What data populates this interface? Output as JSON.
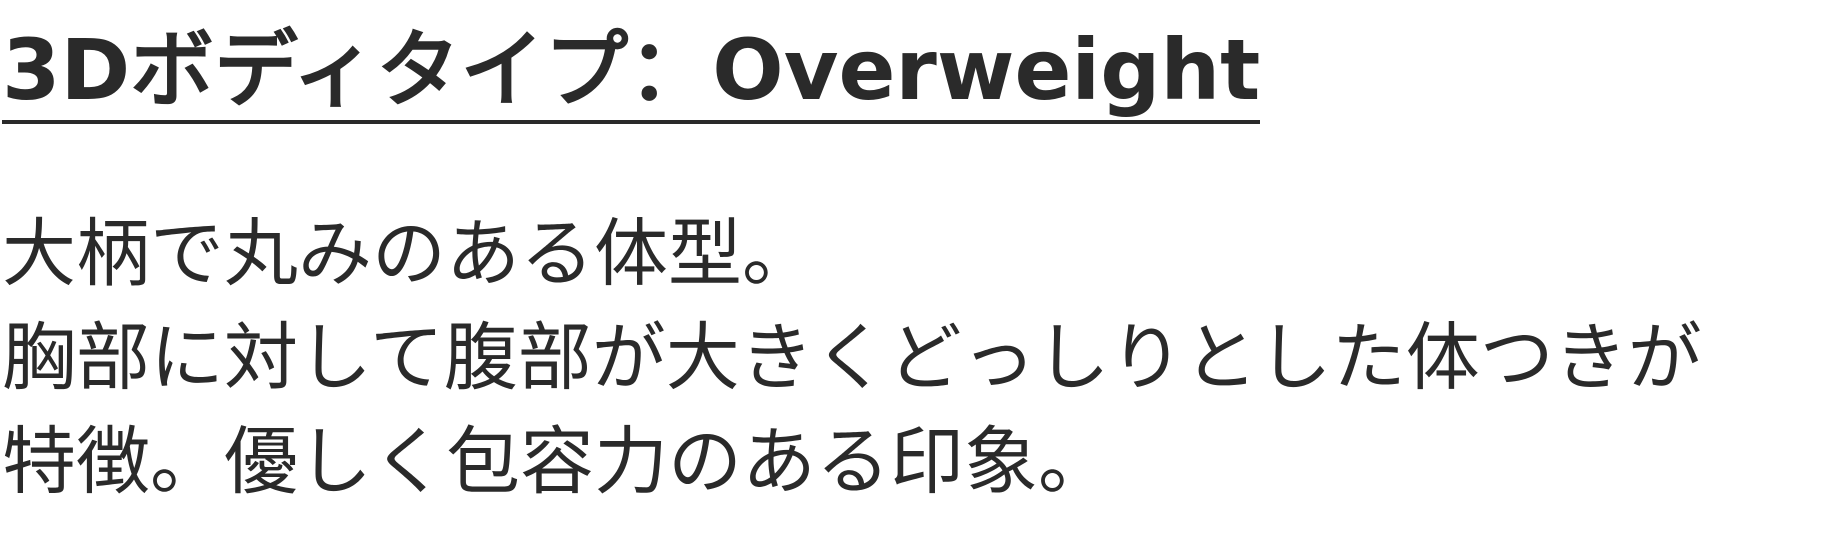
{
  "document": {
    "title": "3Dボディタイプ：Overweight",
    "lines": [
      "大柄で丸みのある体型。",
      "胸部に対して腹部が大きくどっしりとした体つきが",
      "特徴。優しく包容力のある印象。"
    ]
  }
}
